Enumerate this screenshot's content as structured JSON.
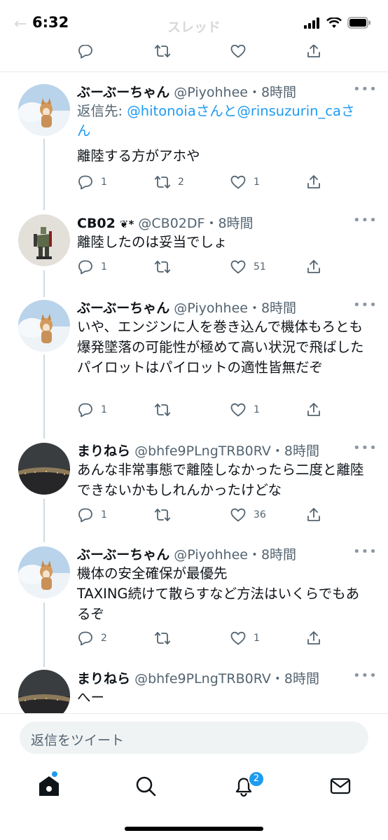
{
  "status_bar": {
    "time": "6:32"
  },
  "nav": {
    "title": "スレッド"
  },
  "colors": {
    "accent": "#1d9bf0",
    "secondary_text": "#536471",
    "thread_line": "#cfd9de"
  },
  "top_actions": {
    "reply_count": "",
    "retweet_count": "",
    "like_count": ""
  },
  "tweets": [
    {
      "name": "ぶーぶーちゃん",
      "handle": "@Piyohhee",
      "time": "・8時間",
      "reply_prefix": "返信先: ",
      "reply_to_1": "@hitonoia",
      "reply_mid": "さんと",
      "reply_to_2": "@rinsuzurin_ca",
      "reply_suffix": "さん",
      "text": "離陸する方がアホや",
      "reply_count": "1",
      "retweet_count": "2",
      "like_count": "1"
    },
    {
      "name": "CB02",
      "name_emoji": "❦*",
      "handle": "@CB02DF",
      "time": "・8時間",
      "text": "離陸したのは妥当でしょ",
      "reply_count": "1",
      "retweet_count": "",
      "like_count": "51"
    },
    {
      "name": "ぶーぶーちゃん",
      "handle": "@Piyohhee",
      "time": "・8時間",
      "text": "いや、エンジンに人を巻き込んで機体もろとも爆発墜落の可能性が極めて高い状況で飛ばしたパイロットはパイロットの適性皆無だぞ",
      "reply_count": "1",
      "retweet_count": "",
      "like_count": "1"
    },
    {
      "name": "まりねら",
      "handle": "@bhfe9PLngTRB0RV",
      "time": "・8時間",
      "text": "あんな非常事態で離陸しなかったら二度と離陸できないかもしれんかったけどな",
      "reply_count": "1",
      "retweet_count": "",
      "like_count": "36"
    },
    {
      "name": "ぶーぶーちゃん",
      "handle": "@Piyohhee",
      "time": "・8時間",
      "text": "機体の安全確保が最優先\nTAXING続けて散らすなど方法はいくらでもあるぞ",
      "reply_count": "2",
      "retweet_count": "",
      "like_count": "1"
    },
    {
      "name": "まりねら",
      "handle": "@bhfe9PLngTRB0RV",
      "time": "・8時間",
      "text": "へー"
    }
  ],
  "reply_bar": {
    "placeholder": "返信をツイート"
  },
  "tab_bar": {
    "notifications_badge": "2"
  }
}
